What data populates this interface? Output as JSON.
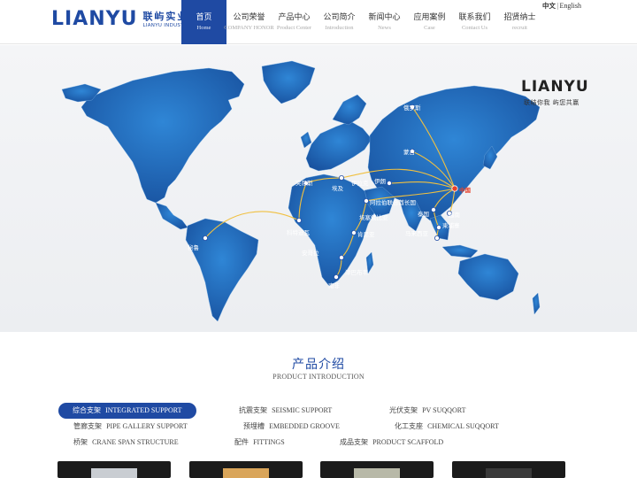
{
  "logo": {
    "wordmark": "LIANYU",
    "cn": "联屿实业",
    "en": "LIANYU INDUSTRIAL"
  },
  "nav": [
    {
      "cn": "首页",
      "en": "Home",
      "active": true
    },
    {
      "cn": "公司荣誉",
      "en": "COMPANY HONOR",
      "active": false
    },
    {
      "cn": "产品中心",
      "en": "Product Center",
      "active": false
    },
    {
      "cn": "公司简介",
      "en": "Introduction",
      "active": false
    },
    {
      "cn": "新闻中心",
      "en": "News",
      "active": false
    },
    {
      "cn": "应用案例",
      "en": "Case",
      "active": false
    },
    {
      "cn": "联系我们",
      "en": "Contact Us",
      "active": false
    },
    {
      "cn": "招贤纳士",
      "en": "recruit",
      "active": false
    }
  ],
  "lang": {
    "zh": "中文",
    "sep": "|",
    "en": "English"
  },
  "banner": {
    "brand": "LIANYU",
    "slogan": "联结你我 屿您共赢",
    "cities": [
      "俄罗斯",
      "蒙古",
      "中国",
      "伊拉克",
      "伊朗",
      "阿拉伯联合酋长国",
      "埃及",
      "突尼斯",
      "埃塞俄比亚",
      "科特迪瓦",
      "肯尼亚",
      "安哥拉",
      "津巴布韦",
      "南非",
      "秘鲁",
      "泰国",
      "越南",
      "柬埔寨",
      "马来西亚"
    ]
  },
  "products": {
    "title": "产品介绍",
    "subtitle": "PRODUCT INTRODUCTION",
    "categories": [
      {
        "cn": "综合支架",
        "en": "INTEGRATED SUPPORT",
        "active": true
      },
      {
        "cn": "抗震支架",
        "en": "SEISMIC SUPPORT",
        "active": false
      },
      {
        "cn": "光伏支架",
        "en": "PV SUQQORT",
        "active": false
      },
      {
        "cn": "管廊支架",
        "en": "PIPE GALLERY SUPPORT",
        "active": false
      },
      {
        "cn": "预埋槽",
        "en": "EMBEDDED GROOVE",
        "active": false
      },
      {
        "cn": "化工支座",
        "en": "CHEMICAL SUQQORT",
        "active": false
      },
      {
        "cn": "桥架",
        "en": "CRANE SPAN STRUCTURE",
        "active": false
      },
      {
        "cn": "配件",
        "en": "FITTINGS",
        "active": false
      },
      {
        "cn": "成品支架",
        "en": "PRODUCT SCAFFOLD",
        "active": false
      }
    ]
  },
  "colors": {
    "brand_blue": "#1f4aa3",
    "map_blue": "#1d5fb0",
    "route": "#f0c040",
    "china_red": "#e8412a"
  }
}
